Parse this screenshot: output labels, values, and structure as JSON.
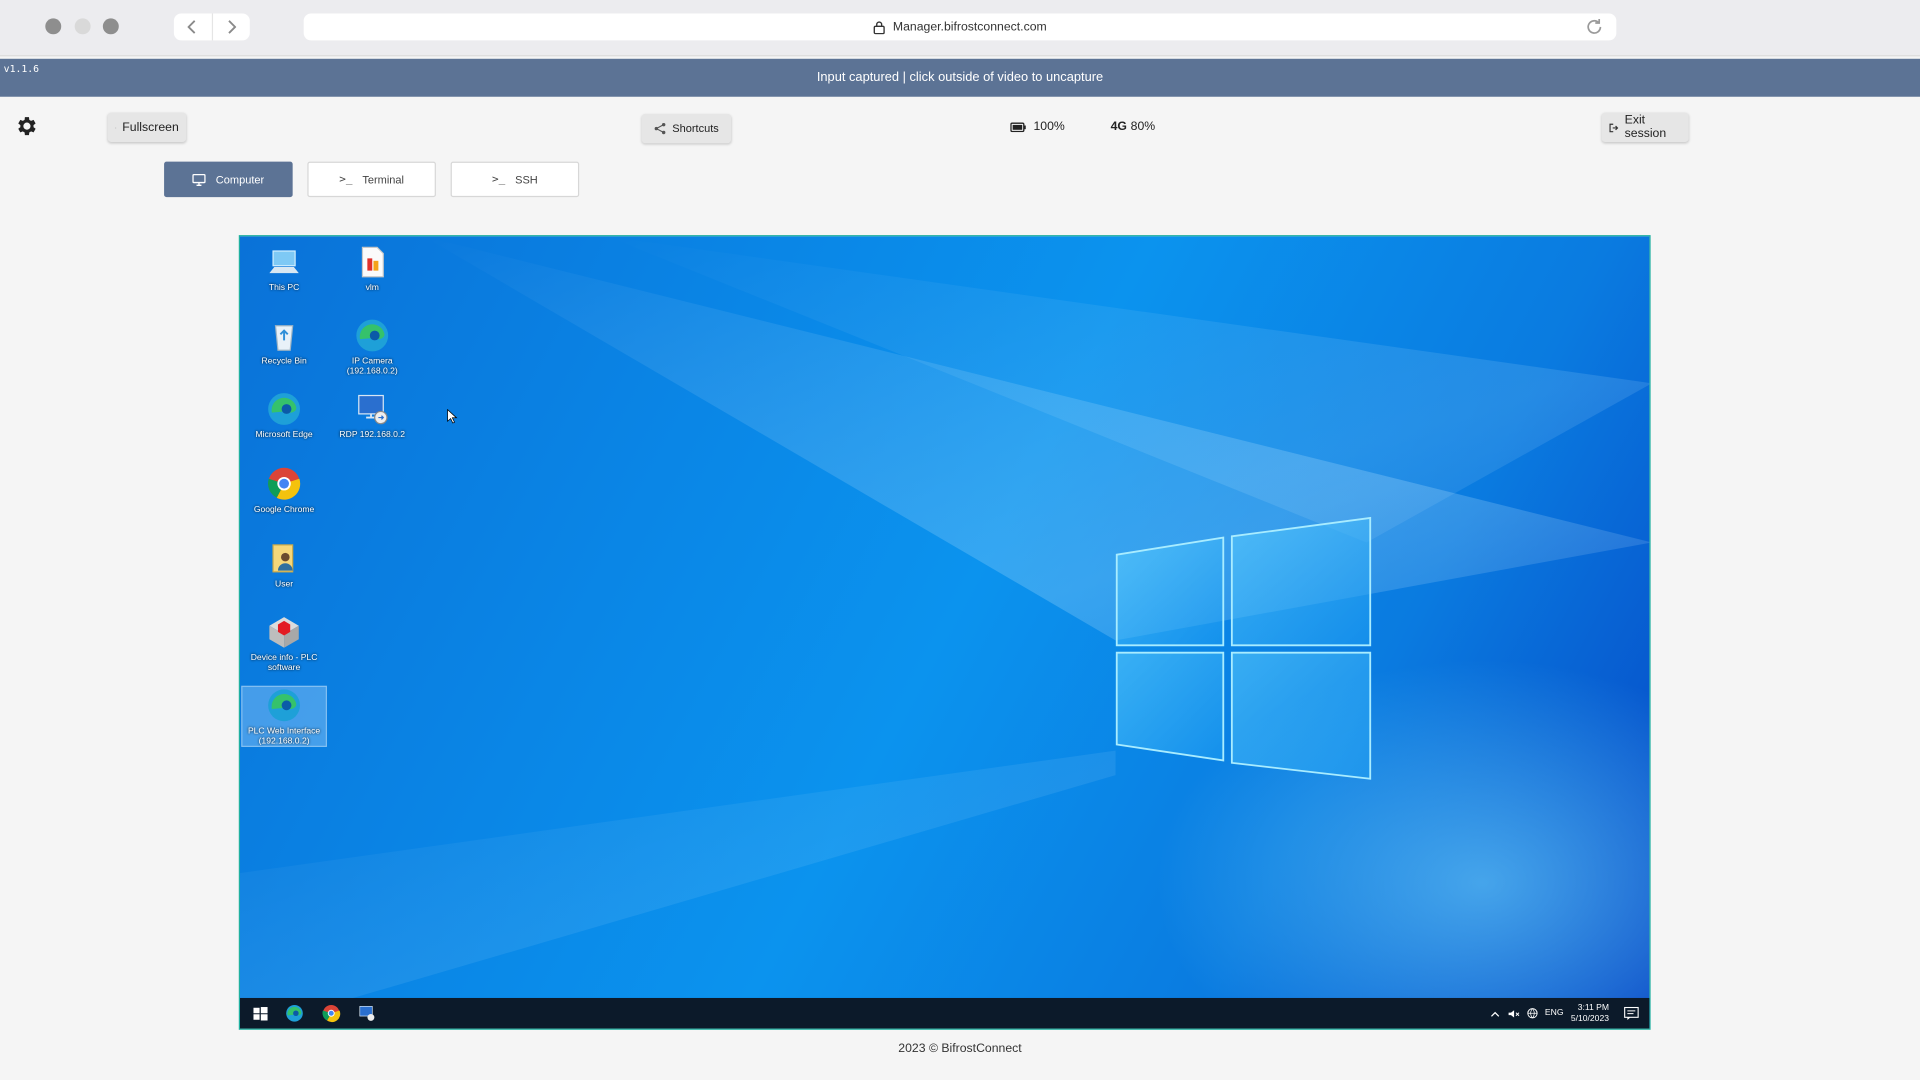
{
  "browser": {
    "url": "Manager.bifrostconnect.com"
  },
  "banner": {
    "version": "v1.1.6",
    "message": "Input captured | click outside of video to uncapture"
  },
  "toolbar": {
    "fullscreen_label": "Fullscreen",
    "shortcuts_label": "Shortcuts",
    "battery": "100%",
    "network_type": "4G",
    "signal": "80%",
    "exit_label": "Exit session"
  },
  "modes": [
    {
      "label": "Computer",
      "active": true
    },
    {
      "label": "Terminal",
      "active": false
    },
    {
      "label": "SSH",
      "active": false
    }
  ],
  "desktop": {
    "icons": [
      {
        "label": "This PC",
        "icon": "this-pc-icon"
      },
      {
        "label": "Recycle Bin",
        "icon": "recycle-bin-icon"
      },
      {
        "label": "Microsoft Edge",
        "icon": "edge-icon"
      },
      {
        "label": "Google Chrome",
        "icon": "chrome-icon"
      },
      {
        "label": "User",
        "icon": "user-folder-icon"
      },
      {
        "label": "Device info - PLC software",
        "icon": "plc-software-icon"
      },
      {
        "label": "PLC Web Interface (192.168.0.2)",
        "icon": "edge-icon"
      },
      {
        "label": "vlm",
        "icon": "file-icon"
      },
      {
        "label": "IP Camera (192.168.0.2)",
        "icon": "edge-icon"
      },
      {
        "label": "RDP 192.168.0.2",
        "icon": "rdp-icon"
      }
    ],
    "taskbar": {
      "language": "ENG",
      "time": "3:11 PM",
      "date": "5/10/2023"
    }
  },
  "footer": "2023 © BifrostConnect",
  "colors": {
    "accent": "#5c7395",
    "desktop": "#0a86e6",
    "taskbar": "#0c1a2a"
  }
}
